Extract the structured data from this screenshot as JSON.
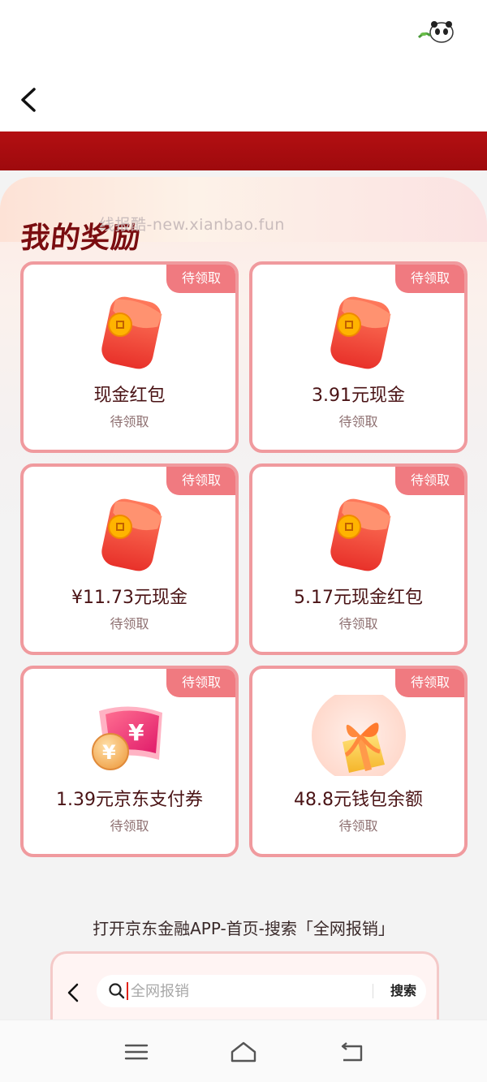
{
  "nav": {
    "back_icon": "chevron-left-icon"
  },
  "status_bar": {
    "mascot_icon": "panda-mascot-icon"
  },
  "rewards": {
    "title": "我的奖励",
    "watermark": "线报酷-new.xianbao.fun",
    "items": [
      {
        "title": "现金红包",
        "status": "待领取",
        "badge": "待领取",
        "icon": "red-envelope-icon"
      },
      {
        "title": "3.91元现金",
        "status": "待领取",
        "badge": "待领取",
        "icon": "red-envelope-icon"
      },
      {
        "title": "¥11.73元现金",
        "status": "待领取",
        "badge": "待领取",
        "icon": "red-envelope-icon"
      },
      {
        "title": "5.17元现金红包",
        "status": "待领取",
        "badge": "待领取",
        "icon": "red-envelope-icon"
      },
      {
        "title": "1.39元京东支付券",
        "status": "待领取",
        "badge": "待领取",
        "icon": "payment-coupon-icon"
      },
      {
        "title": "48.8元钱包余额",
        "status": "待领取",
        "badge": "待领取",
        "icon": "gift-box-icon"
      }
    ]
  },
  "instructions": {
    "text": "打开京东金融APP-首页-搜索「全网报销」"
  },
  "search_demo": {
    "placeholder": "全网报销",
    "button_label": "搜索"
  },
  "colors": {
    "brand_red": "#9e0a0d",
    "card_border": "#f09a9e",
    "badge": "#f07a80",
    "title": "#7a0d10"
  }
}
